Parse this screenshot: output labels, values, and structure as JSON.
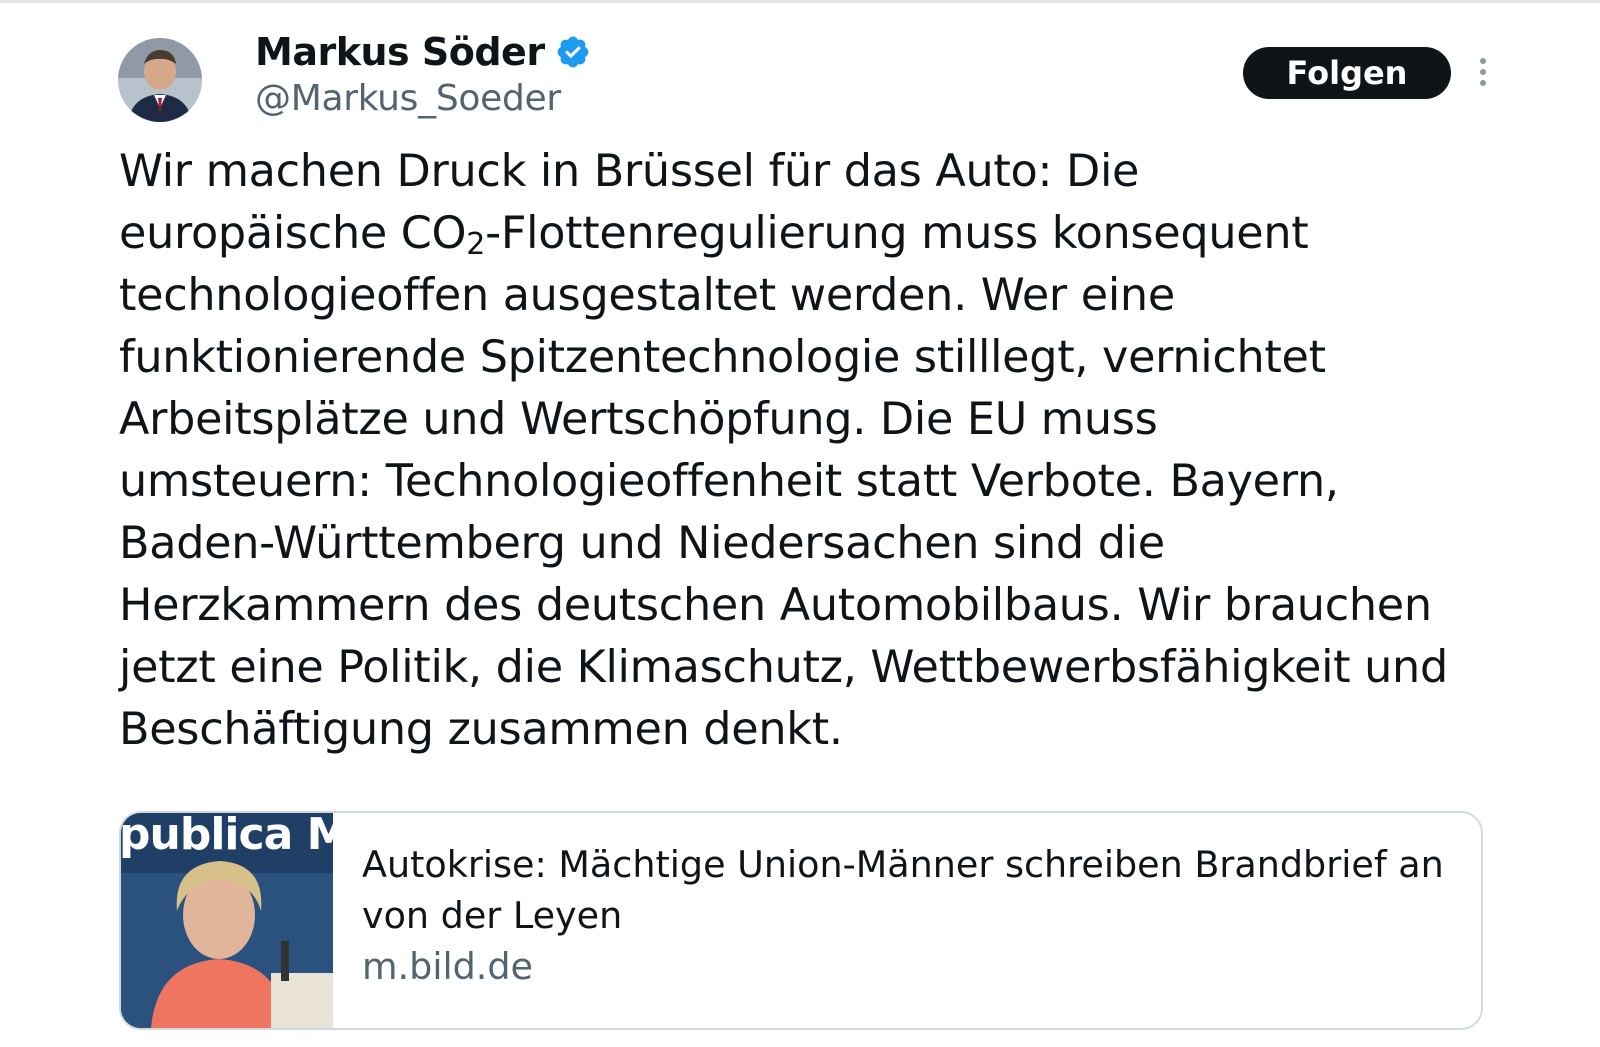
{
  "author": {
    "display_name": "Markus Söder",
    "handle": "@Markus_Soeder",
    "verified": true,
    "avatar_icon": "profile-photo"
  },
  "actions": {
    "follow_label": "Folgen",
    "more_icon": "more-vertical-icon"
  },
  "tweet": {
    "lines": [
      "Wir machen Druck in Brüssel für das Auto: Die",
      "europäische CO",
      "-Flottenregulierung muss konsequent",
      "technologieoffen ausgestaltet werden. Wer eine",
      "funktionierende Spitzentechnologie stilllegt, vernichtet",
      "Arbeitsplätze und Wertschöpfung. Die EU muss",
      "umsteuern: Technologieoffenheit statt Verbote. Bayern,",
      "Baden-Württemberg und Niedersachen sind die",
      "Herzkammern des deutschen Automobilbaus. Wir brauchen",
      "jetzt eine Politik, die Klimaschutz, Wettbewerbsfähigkeit und",
      "Beschäftigung zusammen denkt."
    ],
    "subscript": "2"
  },
  "link_card": {
    "title": "Autokrise: Mächtige Union-Männer schreiben Brandbrief an von der Leyen",
    "domain": "m.bild.de",
    "thumbnail_text": "publica M",
    "thumbnail_icon": "news-photo"
  },
  "colors": {
    "text": "#0f1419",
    "secondary": "#536471",
    "verified": "#1d9bf0",
    "border": "#cfd9de"
  }
}
